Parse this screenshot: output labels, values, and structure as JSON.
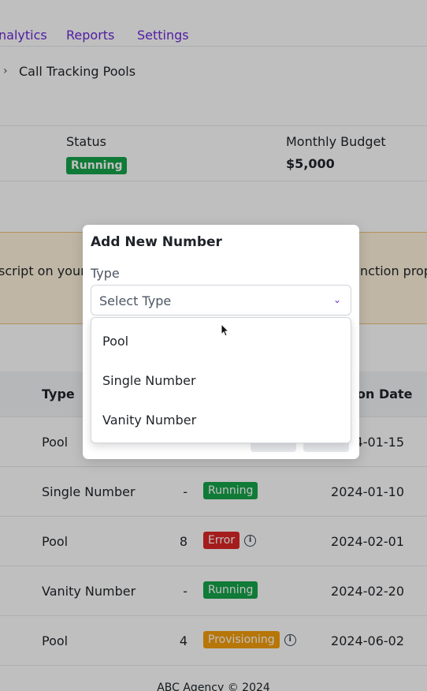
{
  "nav": {
    "items": [
      "nalytics",
      "Reports",
      "Settings"
    ]
  },
  "breadcrumb": {
    "current": "Call Tracking Pools"
  },
  "info": {
    "status_label": "Status",
    "status_value": "Running",
    "budget_label": "Monthly Budget",
    "budget_value": "$5,000"
  },
  "alert": {
    "left_text": "script on your",
    "right_text": "nction prop"
  },
  "table": {
    "headers": {
      "type": "Type",
      "date": "on Date"
    },
    "rows": [
      {
        "type": "Pool",
        "count": "",
        "status": "",
        "date": "24-01-15"
      },
      {
        "type": "Single Number",
        "count": "-",
        "status": "Running",
        "status_color": "#16a34a",
        "info": false,
        "date": "2024-01-10"
      },
      {
        "type": "Pool",
        "count": "8",
        "status": "Error",
        "status_color": "#dc2626",
        "info": true,
        "date": "2024-02-01"
      },
      {
        "type": "Vanity Number",
        "count": "-",
        "status": "Running",
        "status_color": "#16a34a",
        "info": false,
        "date": "2024-02-20"
      },
      {
        "type": "Pool",
        "count": "4",
        "status": "Provisioning",
        "status_color": "#f59e0b",
        "info": true,
        "date": "2024-06-02"
      }
    ]
  },
  "footer": {
    "text": "ABC Agency © 2024"
  },
  "modal": {
    "title": "Add New Number",
    "field_label": "Type",
    "select_placeholder": "Select Type",
    "options": [
      "Pool",
      "Single Number",
      "Vanity Number"
    ]
  },
  "colors": {
    "accent": "#6d28d9",
    "alert_bg": "#fff3dd"
  }
}
